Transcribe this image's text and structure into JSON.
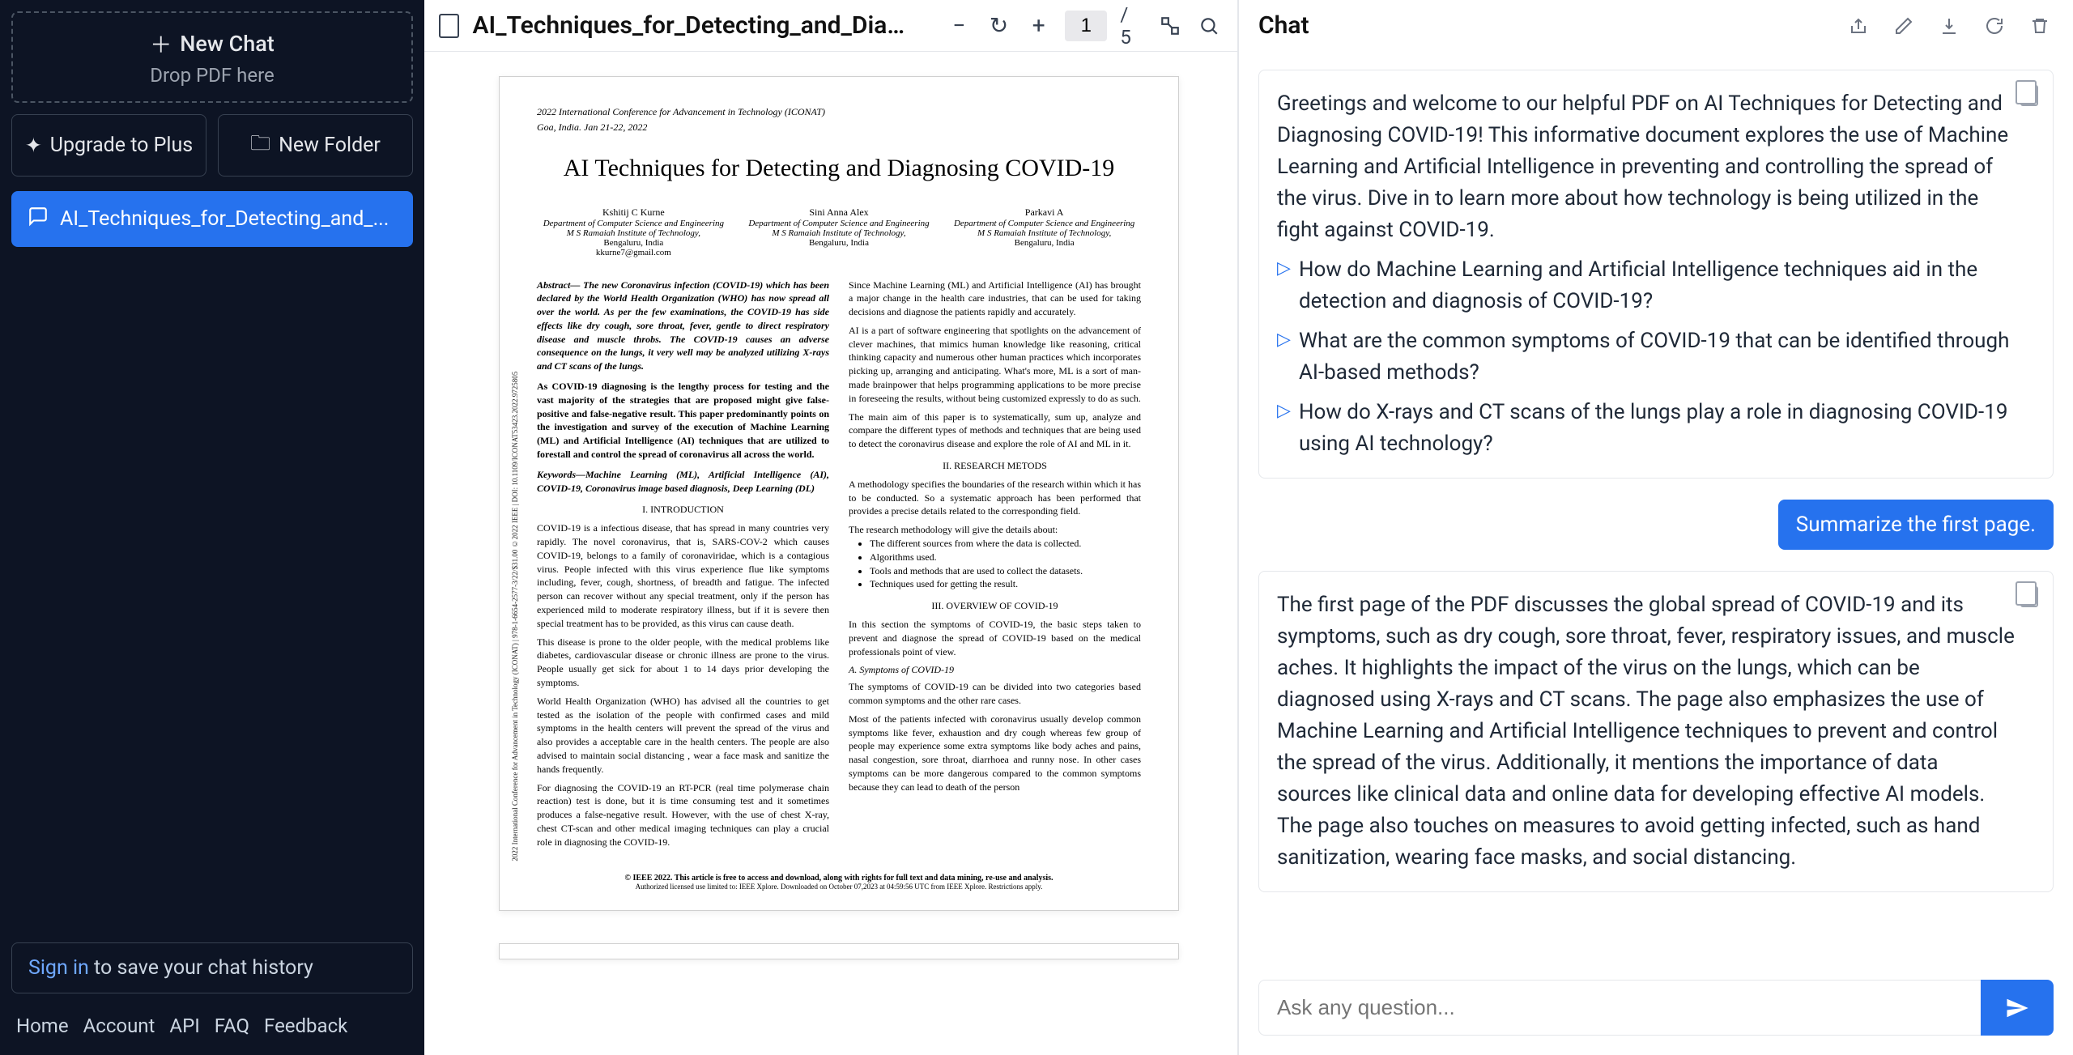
{
  "sidebar": {
    "new_chat_label": "New Chat",
    "drop_pdf_label": "Drop PDF here",
    "upgrade_label": "Upgrade to Plus",
    "new_folder_label": "New Folder",
    "chats": [
      {
        "label": "AI_Techniques_for_Detecting_and_..."
      }
    ],
    "signin_link": "Sign in",
    "signin_rest": " to save your chat history",
    "footer": [
      "Home",
      "Account",
      "API",
      "FAQ",
      "Feedback"
    ]
  },
  "pdf": {
    "toolbar": {
      "title": "AI_Techniques_for_Detecting_and_Diag...",
      "page_current": "1",
      "page_total": "/ 5"
    },
    "page": {
      "conference": "2022 International Conference for Advancement in Technology (ICONAT)",
      "conference_loc": "Goa, India. Jan 21-22, 2022",
      "side_text": "2022 International Conference for Advancement in Technology (ICONAT) | 978-1-6654-2577-3/22/$31.00 ©2022 IEEE | DOI: 10.1109/ICONAT53423.2022.9725805",
      "title": "AI Techniques for Detecting and Diagnosing COVID-19",
      "authors": [
        {
          "name": "Kshitij C Kurne",
          "dept": "Department of Computer Science and Engineering",
          "inst": "M S Ramaiah Institute of Technology,",
          "city": "Bengaluru, India",
          "email": "kkurne7@gmail.com"
        },
        {
          "name": "Sini Anna Alex",
          "dept": "Department of Computer Science and Engineering",
          "inst": "M S Ramaiah Institute of Technology,",
          "city": "Bengaluru, India",
          "email": ""
        },
        {
          "name": "Parkavi A",
          "dept": "Department of Computer Science and Engineering",
          "inst": "M S Ramaiah Institute of Technology,",
          "city": "Bengaluru, India",
          "email": ""
        }
      ],
      "abstract": "Abstract— The new Coronavirus infection (COVID-19) which has been declared by the World Health Organization (WHO) has now spread all over the world. As per the few examinations, the COVID-19 has side effects like dry cough, sore throat, fever, gentle to direct respiratory disease and muscle throbs. The COVID-19 causes an adverse consequence on the lungs, it very well may be analyzed utilizing X-rays and CT scans of the lungs.",
      "para1": "As COVID-19 diagnosing is the lengthy process for testing and the vast majority of the strategies that are proposed might give false-positive and false-negative result. This paper predominantly points on the investigation and survey of the execution of Machine Learning (ML) and Artificial Intelligence (AI) techniques that are utilized to forestall and control the spread of coronavirus all across the world.",
      "keywords": "Keywords—Machine Learning (ML), Artificial Intelligence (AI), COVID-19, Coronavirus image based diagnosis, Deep Learning (DL)",
      "intro_h": "I.    INTRODUCTION",
      "intro_p1": "COVID-19 is a infectious disease, that has spread in many countries very rapidly. The novel coronavirus, that is, SARS-COV-2 which causes COVID-19, belongs to a family of coronaviridae, which is a contagious virus. People infected with this virus experience flue like symptoms including, fever, cough, shortness, of breadth and fatigue. The infected person can recover without any special treatment, only if the person has experienced mild to moderate respiratory illness, but if it is severe then special treatment has to be provided, as this virus can cause death.",
      "intro_p2": "This disease is prone to the older people, with the medical problems like diabetes, cardiovascular disease or chronic illness are prone to the virus. People usually get sick for about 1 to 14 days prior developing the symptoms.",
      "intro_p3": "World Health Organization (WHO) has advised all the countries to get tested as the isolation of the people with confirmed cases and mild symptoms in the health centers will prevent the spread of the virus and also provides a acceptable care in the health centers. The people are also advised to maintain social distancing , wear a face mask and sanitize the hands frequently.",
      "intro_p4": "For diagnosing the COVID-19 an RT-PCR (real time polymerase chain reaction) test is done, but it is time consuming test and it sometimes produces a false-negative result. However, with the use of chest X-ray, chest CT-scan and other medical imaging techniques can play a crucial role in diagnosing the COVID-19.",
      "col2_p1": "Since Machine Learning (ML) and Artificial Intelligence (AI) has brought a major change in the health care industries, that can be used for taking decisions and diagnose the patients rapidly and accurately.",
      "col2_p2": "AI is a part of software engineering that spotlights on the advancement of clever machines, that mimics human knowledge like reasoning, critical thinking capacity and numerous other human practices which incorporates picking up, arranging and anticipating. What's more, ML is a sort of man-made brainpower that helps programming applications to be more precise in foreseeing the results, without being customized expressly to do as such.",
      "col2_p3": "The main aim of this paper is to systematically, sum up, analyze and compare the different types of methods and techniques that are being used to detect the coronavirus disease and explore the role of AI and ML in it.",
      "research_h": "II.    RESEARCH METODS",
      "research_p1": "A methodology specifies the boundaries of the research within which it has to be conducted. So a systematic approach has been performed that provides a precise details related to the corresponding field.",
      "research_p2": "The research methodology will give the details about:",
      "bullets": [
        "The different sources from where the data is collected.",
        "Algorithms used.",
        "Tools and methods that are used to collect the datasets.",
        "Techniques used for getting the result."
      ],
      "overview_h": "III.    OVERVIEW OF COVID-19",
      "overview_p1": "In this section the symptoms of COVID-19, the basic steps taken to prevent and diagnose the spread of COVID-19 based on the medical professionals point of view.",
      "symp_h": "A. Symptoms of COVID-19",
      "symp_p1": "The symptoms of COVID-19 can be divided into two categories based common symptoms and the other rare cases.",
      "symp_p2": "Most of the patients infected with coronavirus usually develop common symptoms like fever, exhaustion and dry cough whereas few group of people may experience some extra symptoms like body aches and pains, nasal congestion, sore throat, diarrhoea and runny nose. In other cases symptoms can be more dangerous compared to the common symptoms because they can lead to death of the person",
      "footer1": "© IEEE 2022. This article is free to access and download, along with rights for full text and data mining, re-use and analysis.",
      "footer2": "Authorized licensed use limited to: IEEE Xplore. Downloaded on October 07,2023 at 04:59:56 UTC from IEEE Xplore. Restrictions apply."
    }
  },
  "chat": {
    "header_title": "Chat",
    "messages": {
      "greeting": "Greetings and welcome to our helpful PDF on AI Techniques for Detecting and Diagnosing COVID-19! This informative document explores the use of Machine Learning and Artificial Intelligence in preventing and controlling the spread of the virus. Dive in to learn more about how technology is being utilized in the fight against COVID-19.",
      "suggestions": [
        "How do Machine Learning and Artificial Intelligence techniques aid in the detection and diagnosis of COVID-19?",
        "What are the common symptoms of COVID-19 that can be identified through AI-based methods?",
        "How do X-rays and CT scans of the lungs play a role in diagnosing COVID-19 using AI technology?"
      ],
      "user1": "Summarize the first page.",
      "assistant2": "The first page of the PDF discusses the global spread of COVID-19 and its symptoms, such as dry cough, sore throat, fever, respiratory issues, and muscle aches. It highlights the impact of the virus on the lungs, which can be diagnosed using X-rays and CT scans. The page also emphasizes the use of Machine Learning and Artificial Intelligence techniques to prevent and control the spread of the virus. Additionally, it mentions the importance of data sources like clinical data and online data for developing effective AI models. The page also touches on measures to avoid getting infected, such as hand sanitization, wearing face masks, and social distancing."
    },
    "input_placeholder": "Ask any question..."
  }
}
